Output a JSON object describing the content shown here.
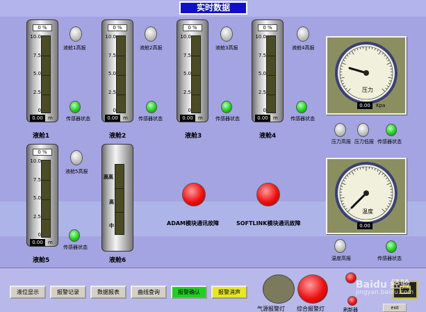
{
  "title": "实时数据",
  "tank_scale": [
    "10.0",
    "7.5",
    "5.0",
    "2.5",
    "0"
  ],
  "pct_unit": "%",
  "pct_value": "0",
  "level_unit": "m",
  "tanks": [
    {
      "name": "液舱1",
      "reading": "0.00",
      "alarm": "液舱1高报",
      "sensor": "传感器状态"
    },
    {
      "name": "液舱2",
      "reading": "0.00",
      "alarm": "液舱2高报",
      "sensor": "传感器状态"
    },
    {
      "name": "液舱3",
      "reading": "0.00",
      "alarm": "液舱3高报",
      "sensor": "传感器状态"
    },
    {
      "name": "液舱4",
      "reading": "0.00",
      "alarm": "液舱4高报",
      "sensor": "传感器状态"
    },
    {
      "name": "液舱5",
      "reading": "0.00",
      "alarm": "液舱5高报",
      "sensor": "传感器状态"
    }
  ],
  "tank6": {
    "name": "液舱6",
    "levels": [
      "高高",
      "高",
      "中"
    ]
  },
  "pressure_gauge": {
    "label": "压力",
    "reading": "0.00",
    "unit": "Kpa"
  },
  "temperature_gauge": {
    "label": "温度",
    "reading": "0.00"
  },
  "pressure_alarms": [
    "压力高报",
    "压力低报"
  ],
  "sensor_status": "传感器状态",
  "temperature_alarm": "温度高报",
  "comm_faults": [
    "ADAM模块通讯故障",
    "SOFTLINK模块通讯故障"
  ],
  "buttons": [
    "液位显示",
    "报警记录",
    "数据报表",
    "曲线查询",
    "报警确认",
    "报警消声"
  ],
  "lamps": [
    "气源报警灯",
    "综合报警灯",
    "刷新器"
  ],
  "exit_label": "exit",
  "watermark": "Baidu 经验",
  "watermark_url": "jingyan.baidu.com",
  "colors": {
    "title_bg": "#1010c8",
    "background": "#a9a9e6",
    "green_button": "#20d020",
    "yellow_button": "#e8e820",
    "alarm_red": "#f01010",
    "ok_green": "#1fd41f"
  }
}
